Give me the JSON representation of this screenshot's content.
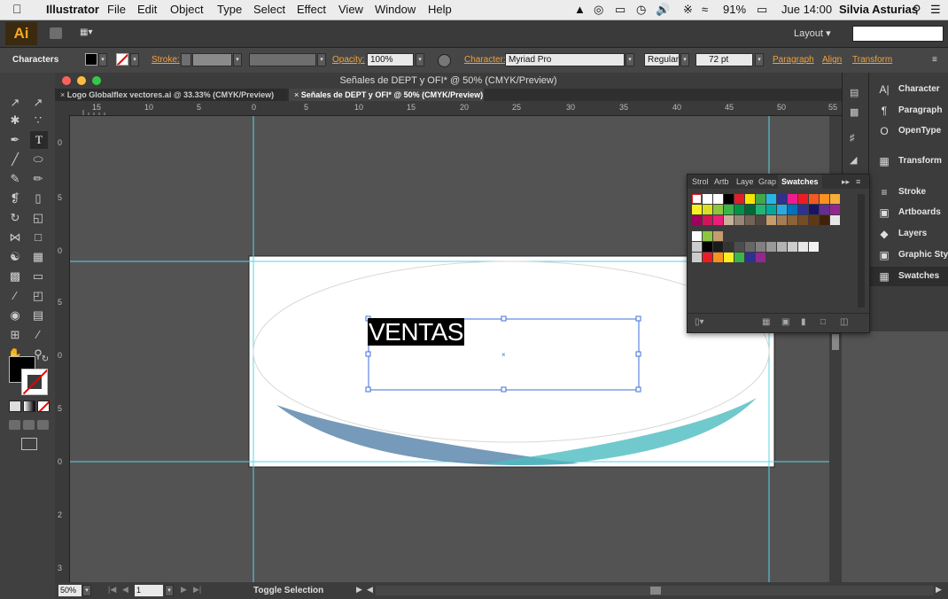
{
  "menubar": {
    "app": "Illustrator",
    "items": [
      "File",
      "Edit",
      "Object",
      "Type",
      "Select",
      "Effect",
      "View",
      "Window",
      "Help"
    ],
    "battery": "91%",
    "clock": "Jue 14:00",
    "user": "Silvia Asturias"
  },
  "appbar": {
    "logo": "Ai",
    "workspace": "Layout"
  },
  "control": {
    "mode": "Characters",
    "stroke_label": "Stroke:",
    "opacity_label": "Opacity:",
    "opacity_value": "100%",
    "character_label": "Character:",
    "font": "Myriad Pro",
    "style": "Regular",
    "size": "72 pt",
    "paragraph_label": "Paragraph",
    "align_label": "Align",
    "transform_label": "Transform"
  },
  "document": {
    "window_title": "Señales de DEPT y OFI* @ 50% (CMYK/Preview)",
    "tabs": [
      "Logo Globalflex vectores.ai @ 33.33% (CMYK/Preview)",
      "Señales de DEPT y OFI* @ 50% (CMYK/Preview)"
    ],
    "ruler_h": [
      "15",
      "10",
      "5",
      "0",
      "5",
      "10",
      "15",
      "20",
      "25",
      "30",
      "35",
      "40",
      "45",
      "50",
      "55"
    ],
    "ruler_v": [
      "0",
      "5",
      "0",
      "5",
      "0",
      "5",
      "0",
      "5",
      "2",
      "5",
      "3"
    ],
    "artwork_text": "VENTAS"
  },
  "status": {
    "zoom": "50%",
    "artboard": "1",
    "message": "Toggle Selection"
  },
  "panels": {
    "items": [
      "Character",
      "Paragraph",
      "OpenType",
      "Transform",
      "Stroke",
      "Artboards",
      "Layers",
      "Graphic Styles",
      "Swatches"
    ],
    "swatch_tabs": [
      "Strol",
      "Artb",
      "Laye",
      "Grap",
      "Swatches"
    ]
  },
  "colors": {
    "accent": "#f0a23c",
    "guide": "#5bd6e0",
    "selection": "#3d6fd9",
    "swoosh_blue": "#5e88ad",
    "swoosh_teal": "#4cbcc0"
  }
}
